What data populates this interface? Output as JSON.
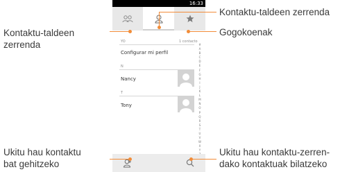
{
  "callouts": {
    "group_list_left": "Kontaktu-taldeen\nzerrenda",
    "group_list_top": "Kontaktu-taldeen zerrenda",
    "favorites": "Gogokoenak",
    "add_contact": "Ukitu hau kontaktu\nbat gehitzeko",
    "search_contacts": "Ukitu hau kontaktu-zerren-\ndako kontaktuak bilatzeko"
  },
  "phone": {
    "status_time": "16:33",
    "tabs": [
      "groups-icon",
      "contacts-icon",
      "favorites-icon"
    ],
    "active_tab": 1,
    "sections": {
      "me_header": "YO",
      "me_count": "1 contacto",
      "n_header": "N",
      "t_header": "T"
    },
    "contacts": {
      "me": "Configurar mi perfil",
      "nancy": "Nancy",
      "tony": "Tony"
    },
    "alphabet": [
      "#",
      "A",
      "B",
      "C",
      "D",
      "E",
      "F",
      "G",
      "H",
      "I",
      "J",
      "K",
      "L",
      "M",
      "N",
      "O",
      "P",
      "Q",
      "R",
      "S",
      "T",
      "U",
      "V",
      "W",
      "X",
      "Y",
      "Z"
    ],
    "bottom_icons": [
      "add-contact-icon",
      "search-icon"
    ]
  },
  "colors": {
    "accent": "#f28c38",
    "text": "#3a3a3a"
  }
}
